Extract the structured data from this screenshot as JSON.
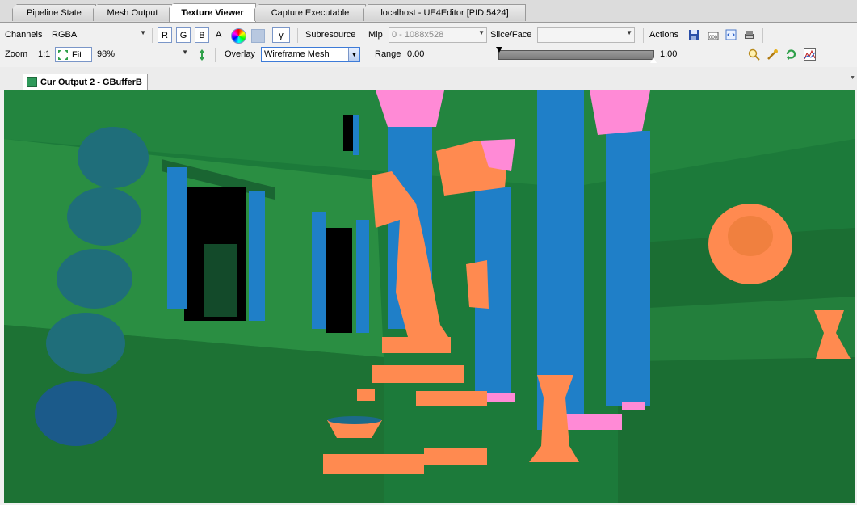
{
  "tabs": [
    {
      "label": "Pipeline State"
    },
    {
      "label": "Mesh Output"
    },
    {
      "label": "Texture Viewer"
    },
    {
      "label": "Capture Executable"
    },
    {
      "label": "localhost - UE4Editor [PID 5424]"
    }
  ],
  "toolbar1": {
    "channels_label": "Channels",
    "channels_value": "RGBA",
    "r": "R",
    "g": "G",
    "b": "B",
    "a": "A",
    "gamma": "γ",
    "subresource_label": "Subresource",
    "mip_label": "Mip",
    "mip_value": "0 - 1088x528",
    "sliceface_label": "Slice/Face",
    "sliceface_value": "",
    "actions_label": "Actions"
  },
  "toolbar2": {
    "zoom_label": "Zoom",
    "zoom_ratio": "1:1",
    "fit_label": "Fit",
    "zoom_value": "98%",
    "overlay_label": "Overlay",
    "overlay_value": "Wireframe Mesh",
    "range_label": "Range",
    "range_min": "0.00",
    "range_max": "1.00"
  },
  "subtab": {
    "label": "Cur Output 2 - GBufferB"
  },
  "colors": {
    "accent": "#2a6fd6",
    "scene_green": "#1c7a3a",
    "pillar_blue": "#1f7fc8",
    "statue_orange": "#ff8a50",
    "capital_pink": "#ff8ad6"
  }
}
